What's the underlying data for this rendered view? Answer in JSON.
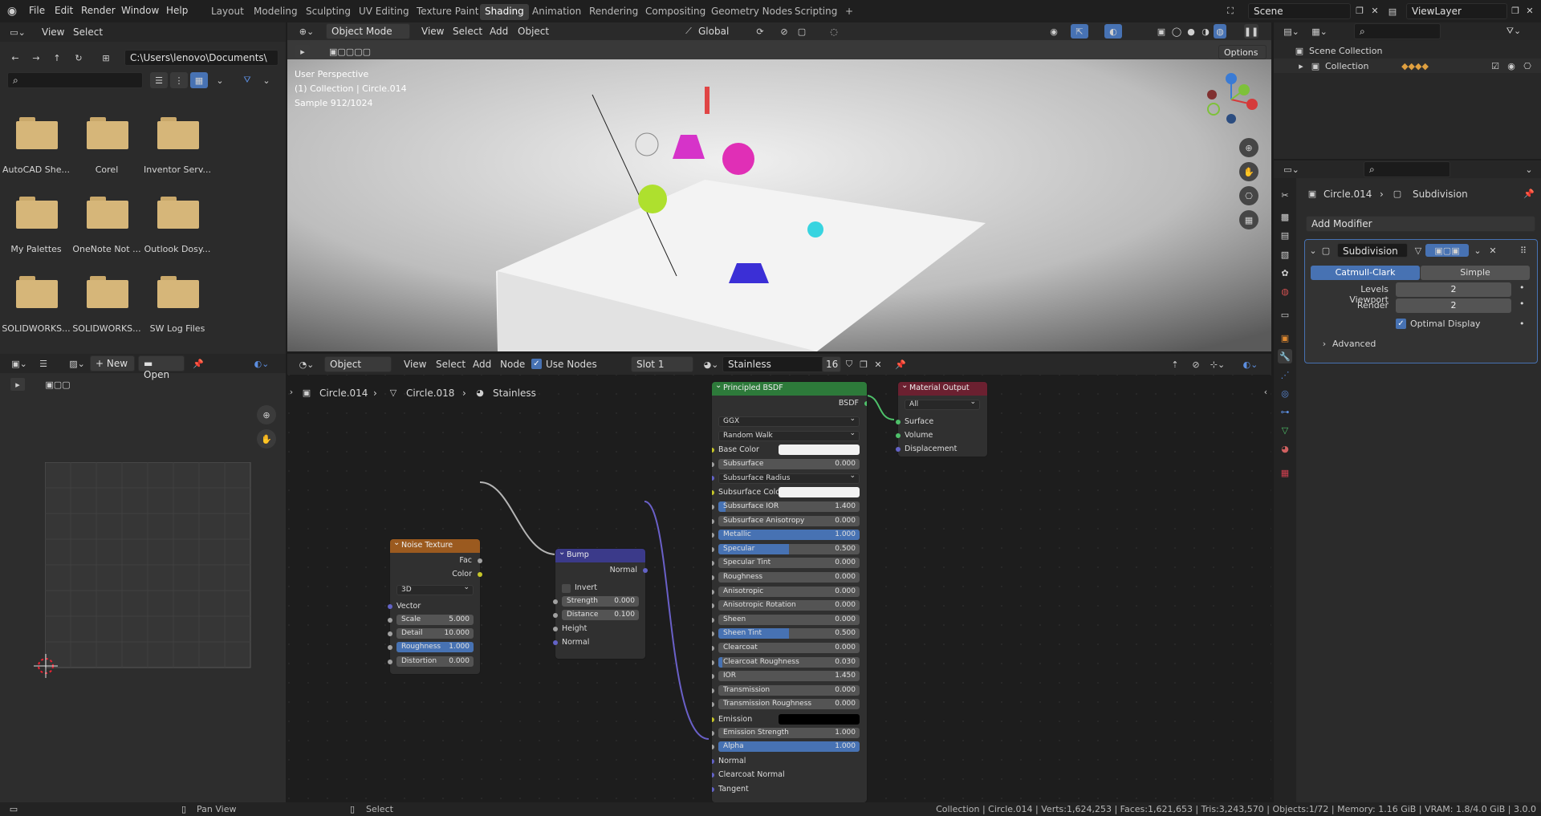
{
  "menu": {
    "file": "File",
    "edit": "Edit",
    "render": "Render",
    "window": "Window",
    "help": "Help"
  },
  "workspaces": [
    "Layout",
    "Modeling",
    "Sculpting",
    "UV Editing",
    "Texture Paint",
    "Shading",
    "Animation",
    "Rendering",
    "Compositing",
    "Geometry Nodes",
    "Scripting",
    "+"
  ],
  "scene": {
    "label": "Scene",
    "view_layer": "ViewLayer"
  },
  "file_browser": {
    "view": "View",
    "select": "Select",
    "path": "C:\\Users\\lenovo\\Documents\\",
    "folders": [
      "AutoCAD She...",
      "Corel",
      "Inventor Serv...",
      "My Palettes",
      "OneNote Not ...",
      "Outlook Dosy...",
      "SOLIDWORKS...",
      "SOLIDWORKS...",
      "SW Log Files"
    ]
  },
  "viewport": {
    "mode": "Object Mode",
    "view": "View",
    "select": "Select",
    "add": "Add",
    "object": "Object",
    "orientation": "Global",
    "options": "Options",
    "overlay_lines": [
      "User Perspective",
      "(1) Collection | Circle.014",
      "Sample 912/1024"
    ]
  },
  "outliner": {
    "scene_collection": "Scene Collection",
    "collection": "Collection"
  },
  "properties": {
    "object": "Circle.014",
    "modifier": "Subdivision",
    "add_modifier": "Add Modifier",
    "mod_name": "Subdivision",
    "catmull": "Catmull-Clark",
    "simple": "Simple",
    "levels_viewport_label": "Levels Viewport",
    "levels_viewport": "2",
    "render_label": "Render",
    "render": "2",
    "optimal_display": "Optimal Display",
    "advanced": "Advanced"
  },
  "image_editor": {
    "new": "New",
    "open": "Open"
  },
  "node_editor": {
    "object": "Object",
    "view": "View",
    "select": "Select",
    "add": "Add",
    "node": "Node",
    "use_nodes": "Use Nodes",
    "slot": "Slot 1",
    "material": "Stainless",
    "users": "16",
    "breadcrumb": [
      "Circle.014",
      "Circle.018",
      "Stainless"
    ]
  },
  "noise": {
    "title": "Noise Texture",
    "fac": "Fac",
    "color": "Color",
    "dim": "3D",
    "vector": "Vector",
    "fields": [
      {
        "label": "Scale",
        "value": "5.000",
        "fill": 0
      },
      {
        "label": "Detail",
        "value": "10.000",
        "fill": 0
      },
      {
        "label": "Roughness",
        "value": "1.000",
        "fill": 1
      },
      {
        "label": "Distortion",
        "value": "0.000",
        "fill": 0
      }
    ]
  },
  "bump": {
    "title": "Bump",
    "normal_out": "Normal",
    "invert": "Invert",
    "fields": [
      {
        "label": "Strength",
        "value": "0.000",
        "fill": 0
      },
      {
        "label": "Distance",
        "value": "0.100",
        "fill": 0
      }
    ],
    "height": "Height",
    "normal_in": "Normal"
  },
  "bsdf": {
    "title": "Principled BSDF",
    "out": "BSDF",
    "dist": "GGX",
    "sss_method": "Random Walk",
    "base_color": "Base Color",
    "subsurface": {
      "label": "Subsurface",
      "value": "0.000",
      "fill": 0
    },
    "subsurface_radius": "Subsurface Radius",
    "subsurface_color": "Subsurface Colo",
    "fields": [
      {
        "label": "Subsurface IOR",
        "value": "1.400",
        "fill": 0.05
      },
      {
        "label": "Subsurface Anisotropy",
        "value": "0.000",
        "fill": 0
      },
      {
        "label": "Metallic",
        "value": "1.000",
        "fill": 1
      },
      {
        "label": "Specular",
        "value": "0.500",
        "fill": 0.5
      },
      {
        "label": "Specular Tint",
        "value": "0.000",
        "fill": 0
      },
      {
        "label": "Roughness",
        "value": "0.000",
        "fill": 0
      },
      {
        "label": "Anisotropic",
        "value": "0.000",
        "fill": 0
      },
      {
        "label": "Anisotropic Rotation",
        "value": "0.000",
        "fill": 0
      },
      {
        "label": "Sheen",
        "value": "0.000",
        "fill": 0
      },
      {
        "label": "Sheen Tint",
        "value": "0.500",
        "fill": 0.5
      },
      {
        "label": "Clearcoat",
        "value": "0.000",
        "fill": 0
      },
      {
        "label": "Clearcoat Roughness",
        "value": "0.030",
        "fill": 0.03
      },
      {
        "label": "IOR",
        "value": "1.450",
        "fill": 0
      },
      {
        "label": "Transmission",
        "value": "0.000",
        "fill": 0
      },
      {
        "label": "Transmission Roughness",
        "value": "0.000",
        "fill": 0
      }
    ],
    "emission": "Emission",
    "emission_strength": {
      "label": "Emission Strength",
      "value": "1.000",
      "fill": 0
    },
    "alpha": {
      "label": "Alpha",
      "value": "1.000",
      "fill": 1
    },
    "normal": "Normal",
    "clearcoat_normal": "Clearcoat Normal",
    "tangent": "Tangent"
  },
  "output": {
    "title": "Material Output",
    "target": "All",
    "surface": "Surface",
    "volume": "Volume",
    "displacement": "Displacement"
  },
  "status": {
    "pan": "Pan View",
    "select": "Select",
    "info": "Collection | Circle.014 | Verts:1,624,253 | Faces:1,621,653 | Tris:3,243,570 | Objects:1/72 | Memory: 1.16 GiB | VRAM: 1.8/4.0 GiB | 3.0.0"
  },
  "colors": {
    "accent": "#4772b3",
    "bsdf_header": "#2d7a3a",
    "noise_header": "#9b5a1f",
    "bump_header": "#3b3a8a",
    "output_header": "#6b2030"
  }
}
